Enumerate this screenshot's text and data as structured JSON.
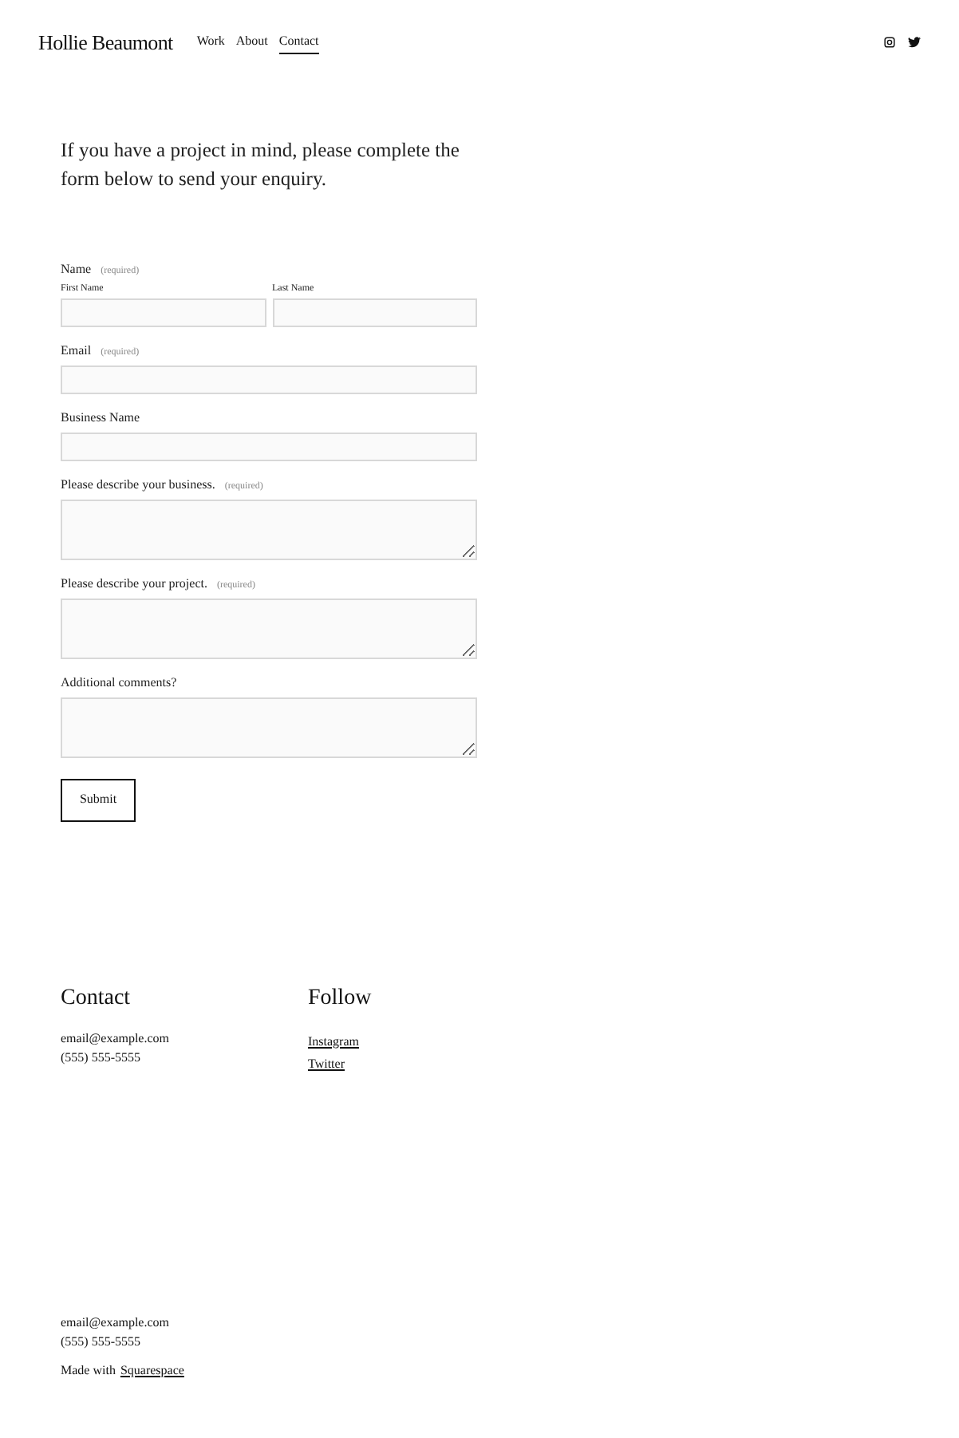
{
  "header": {
    "site_title": "Hollie Beaumont",
    "nav": [
      {
        "label": "Work",
        "selected": false
      },
      {
        "label": "About",
        "selected": false
      },
      {
        "label": "Contact",
        "selected": true
      }
    ]
  },
  "intro": "If you have a project in mind, please complete the form below to send your enquiry.",
  "form": {
    "fields": [
      {
        "kind": "name",
        "label": "Name",
        "required": "(required)",
        "sublabels": [
          "First Name",
          "Last Name"
        ]
      },
      {
        "kind": "input",
        "label": "Email",
        "required": "(required)"
      },
      {
        "kind": "input",
        "label": "Business Name"
      },
      {
        "kind": "textarea",
        "label": "Please describe your business.",
        "required": "(required)"
      },
      {
        "kind": "textarea",
        "label": "Please describe your project.",
        "required": "(required)"
      },
      {
        "kind": "textarea",
        "label": "Additional comments?"
      }
    ],
    "submit": "Submit"
  },
  "contact": {
    "heading": "Contact",
    "lines": [
      "email@example.com",
      "(555) 555-5555"
    ]
  },
  "follow": {
    "heading": "Follow",
    "links": [
      "Instagram",
      "Twitter"
    ]
  },
  "footer": {
    "lines": [
      "email@example.com",
      "(555) 555-5555"
    ],
    "made_with": "Made with",
    "made_with_link": "Squarespace"
  }
}
